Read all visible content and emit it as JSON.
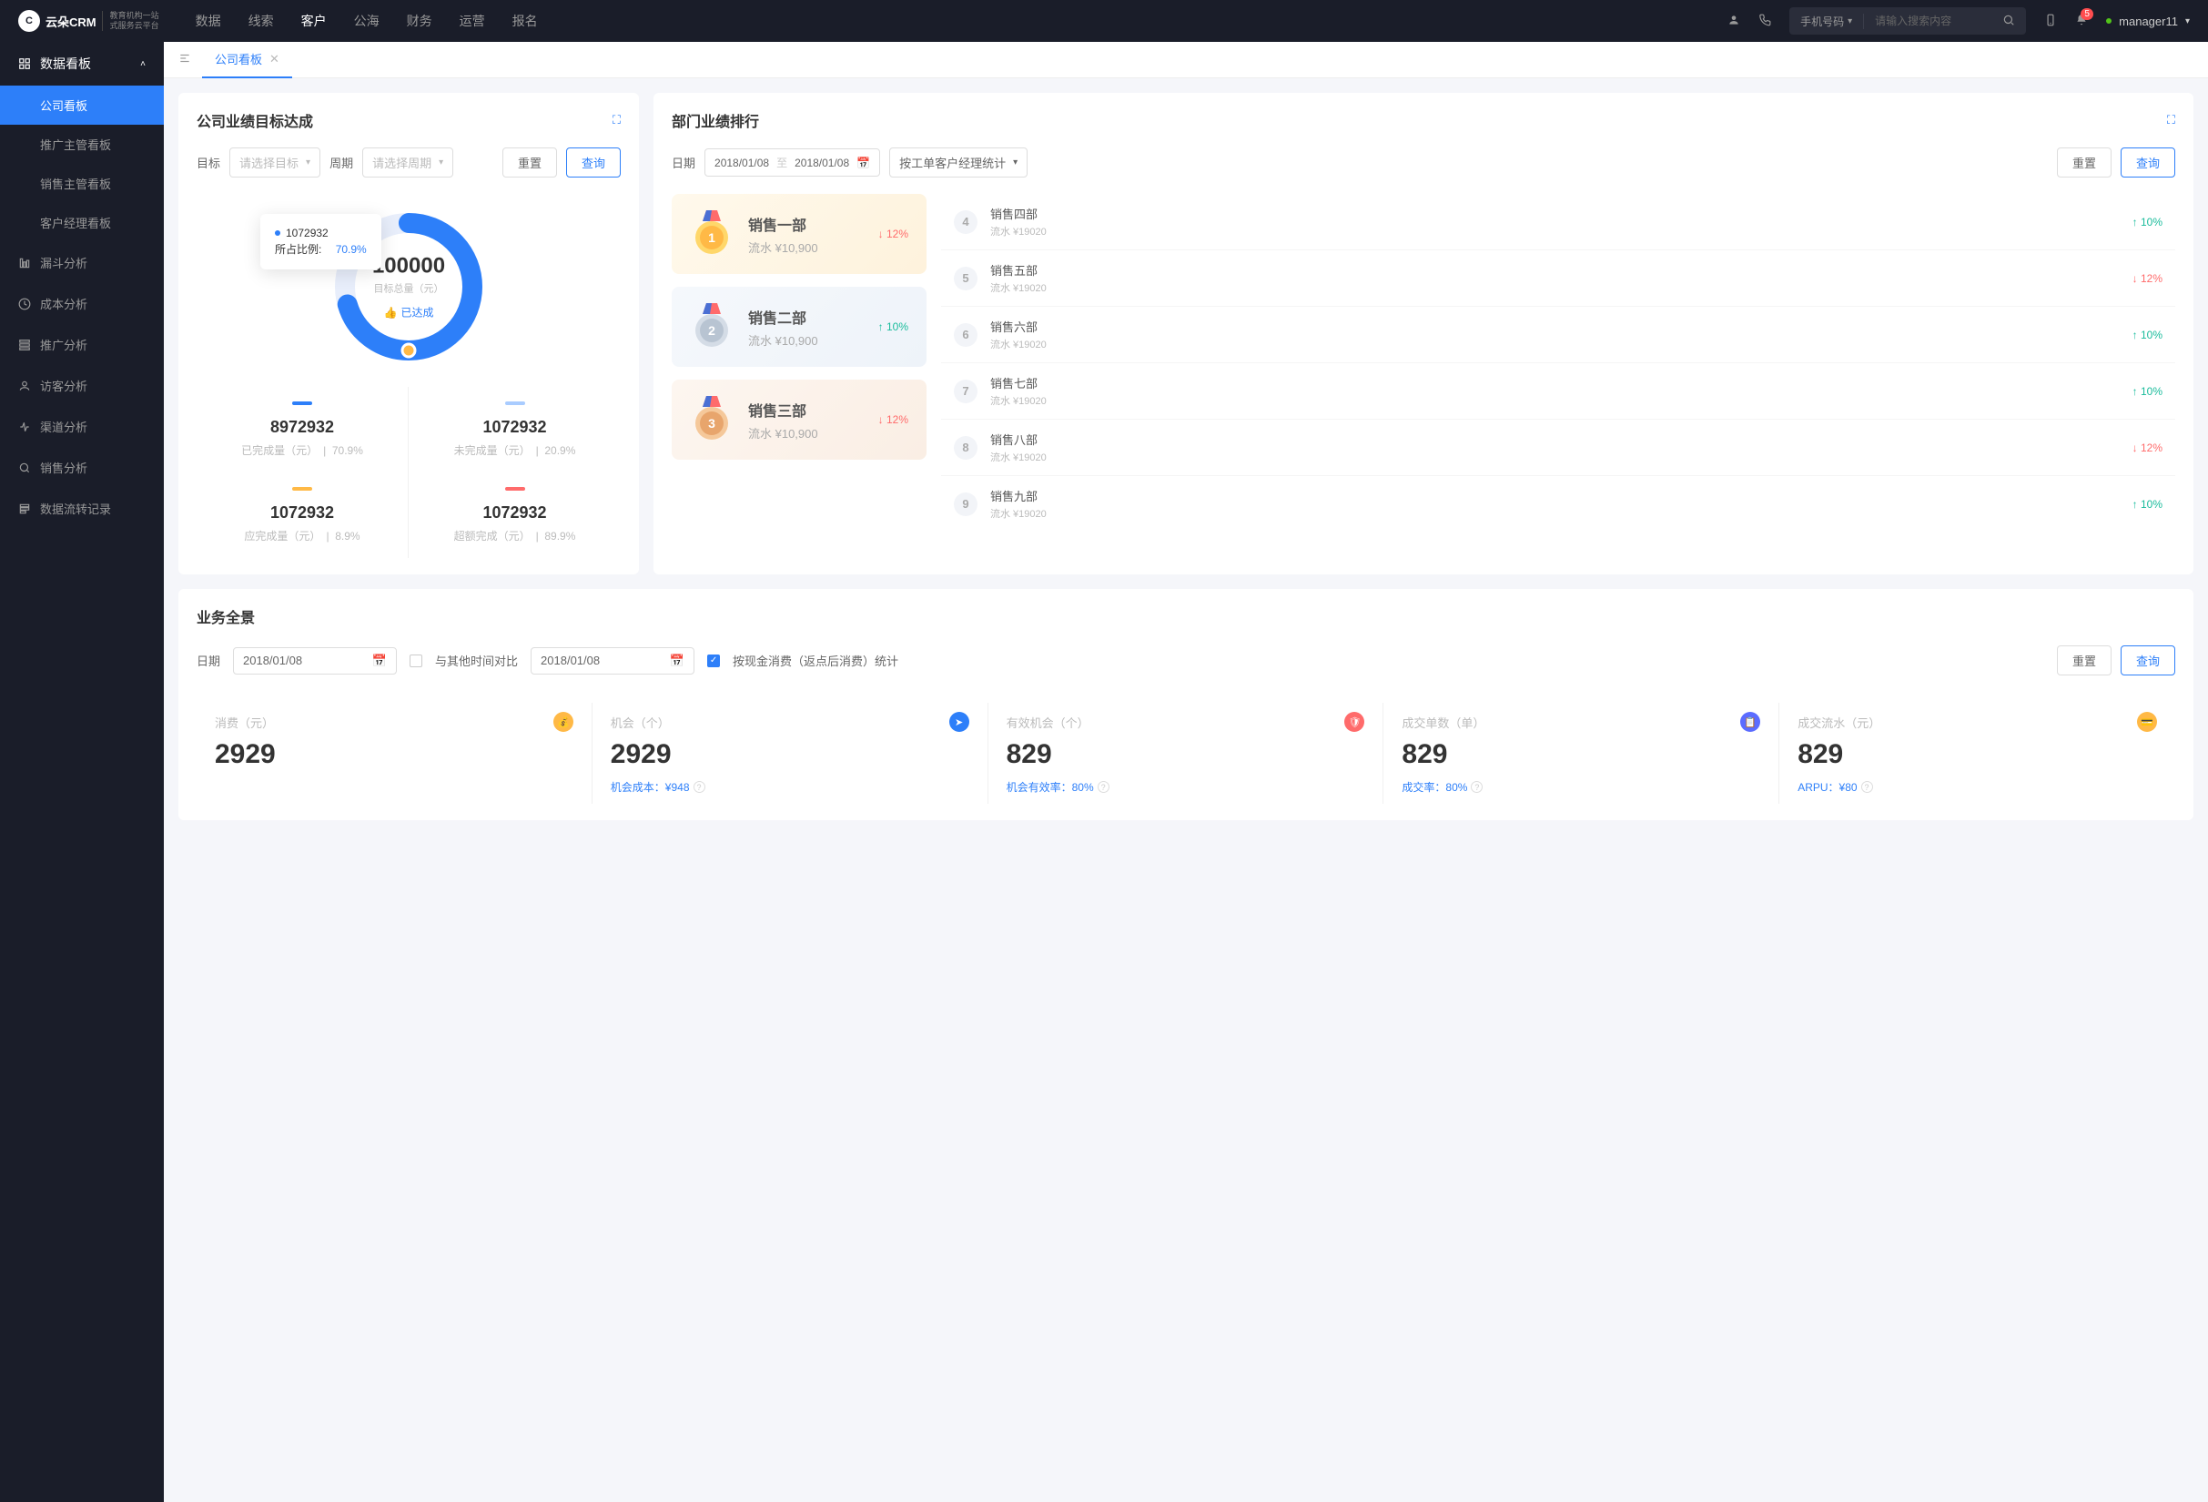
{
  "topbar": {
    "logo_text": "云朵CRM",
    "logo_sub1": "教育机构一站",
    "logo_sub2": "式服务云平台",
    "nav": [
      "数据",
      "线索",
      "客户",
      "公海",
      "财务",
      "运营",
      "报名"
    ],
    "nav_active": 2,
    "search_type": "手机号码",
    "search_placeholder": "请输入搜索内容",
    "badge": "5",
    "user": "manager11"
  },
  "sidebar": {
    "header": "数据看板",
    "sub": [
      "公司看板",
      "推广主管看板",
      "销售主管看板",
      "客户经理看板"
    ],
    "sub_active": 0,
    "items": [
      "漏斗分析",
      "成本分析",
      "推广分析",
      "访客分析",
      "渠道分析",
      "销售分析",
      "数据流转记录"
    ]
  },
  "tabs": {
    "active": "公司看板"
  },
  "target": {
    "title": "公司业绩目标达成",
    "label_target": "目标",
    "ph_target": "请选择目标",
    "label_period": "周期",
    "ph_period": "请选择周期",
    "btn_reset": "重置",
    "btn_query": "查询",
    "tooltip_val": "1072932",
    "tooltip_label": "所占比例:",
    "tooltip_pct": "70.9%",
    "center_num": "100000",
    "center_label": "目标总量（元）",
    "center_badge": "已达成",
    "stats": [
      {
        "bar": "#2d7ff9",
        "num": "8972932",
        "label": "已完成量（元）",
        "pct": "70.9%"
      },
      {
        "bar": "#a9ccff",
        "num": "1072932",
        "label": "未完成量（元）",
        "pct": "20.9%"
      },
      {
        "bar": "#ffb946",
        "num": "1072932",
        "label": "应完成量（元）",
        "pct": "8.9%"
      },
      {
        "bar": "#ff6b6b",
        "num": "1072932",
        "label": "超额完成（元）",
        "pct": "89.9%"
      }
    ]
  },
  "rank": {
    "title": "部门业绩排行",
    "label_date": "日期",
    "date_from": "2018/01/08",
    "date_sep": "至",
    "date_to": "2018/01/08",
    "stat_type": "按工单客户经理统计",
    "btn_reset": "重置",
    "btn_query": "查询",
    "top": [
      {
        "name": "销售一部",
        "val": "流水 ¥10,900",
        "chg": "12%",
        "dir": "down"
      },
      {
        "name": "销售二部",
        "val": "流水 ¥10,900",
        "chg": "10%",
        "dir": "up"
      },
      {
        "name": "销售三部",
        "val": "流水 ¥10,900",
        "chg": "12%",
        "dir": "down"
      }
    ],
    "rest": [
      {
        "n": "4",
        "name": "销售四部",
        "val": "流水 ¥19020",
        "chg": "10%",
        "dir": "up"
      },
      {
        "n": "5",
        "name": "销售五部",
        "val": "流水 ¥19020",
        "chg": "12%",
        "dir": "down"
      },
      {
        "n": "6",
        "name": "销售六部",
        "val": "流水 ¥19020",
        "chg": "10%",
        "dir": "up"
      },
      {
        "n": "7",
        "name": "销售七部",
        "val": "流水 ¥19020",
        "chg": "10%",
        "dir": "up"
      },
      {
        "n": "8",
        "name": "销售八部",
        "val": "流水 ¥19020",
        "chg": "12%",
        "dir": "down"
      },
      {
        "n": "9",
        "name": "销售九部",
        "val": "流水 ¥19020",
        "chg": "10%",
        "dir": "up"
      }
    ]
  },
  "overview": {
    "title": "业务全景",
    "label_date": "日期",
    "date1": "2018/01/08",
    "compare_label": "与其他时间对比",
    "date2": "2018/01/08",
    "checkbox_label": "按现金消费（返点后消费）统计",
    "btn_reset": "重置",
    "btn_query": "查询",
    "metrics": [
      {
        "label": "消费（元）",
        "num": "2929",
        "icon": "#ffb946",
        "sub": ""
      },
      {
        "label": "机会（个）",
        "num": "2929",
        "icon": "#2d7ff9",
        "sub": "机会成本：¥948"
      },
      {
        "label": "有效机会（个）",
        "num": "829",
        "icon": "#ff6b6b",
        "sub": "机会有效率：80%"
      },
      {
        "label": "成交单数（单）",
        "num": "829",
        "icon": "#5b6cff",
        "sub": "成交率：80%"
      },
      {
        "label": "成交流水（元）",
        "num": "829",
        "icon": "#ffb946",
        "sub": "ARPU：¥80"
      }
    ]
  },
  "chart_data": {
    "type": "pie",
    "title": "公司业绩目标达成",
    "total": 100000,
    "total_label": "目标总量（元）",
    "series": [
      {
        "name": "已完成量（元）",
        "value": 8972932,
        "pct": 70.9,
        "color": "#2d7ff9"
      },
      {
        "name": "未完成量（元）",
        "value": 1072932,
        "pct": 20.9,
        "color": "#a9ccff"
      },
      {
        "name": "应完成量（元）",
        "value": 1072932,
        "pct": 8.9,
        "color": "#ffb946"
      },
      {
        "name": "超额完成（元）",
        "value": 1072932,
        "pct": 89.9,
        "color": "#ff6b6b"
      }
    ],
    "highlighted": {
      "value": 1072932,
      "pct": 70.9
    }
  }
}
